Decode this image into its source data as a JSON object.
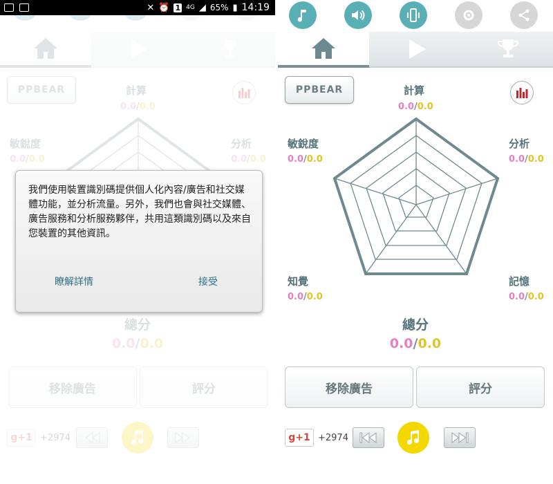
{
  "status_bar": {
    "battery": "65%",
    "time": "14:19",
    "network": "4G",
    "sim": "1"
  },
  "icons": {
    "top": [
      "music-icon",
      "volume-icon",
      "vibrate-icon",
      "settings-icon",
      "share-icon"
    ],
    "nav": [
      "home-icon",
      "play-icon",
      "trophy-icon"
    ]
  },
  "header": {
    "ppbear": "PPBEAR"
  },
  "stats": {
    "calc": {
      "label": "計算",
      "score": "0.0",
      "best": "0.0"
    },
    "sensitivity": {
      "label": "敏銳度",
      "score": "0.0",
      "best": "0.0"
    },
    "analysis": {
      "label": "分析",
      "score": "0.0",
      "best": "0.0"
    },
    "perception": {
      "label": "知覺",
      "score": "0.0",
      "best": "0.0"
    },
    "memory": {
      "label": "記憶",
      "score": "0.0",
      "best": "0.0"
    },
    "total": {
      "label": "總分",
      "score": "0.0",
      "best": "0.0"
    },
    "separator": "/"
  },
  "buttons": {
    "remove_ads": "移除廣告",
    "rate": "評分"
  },
  "social": {
    "gplus": "g+1",
    "count": "+2974"
  },
  "dialog": {
    "message": "我們使用裝置識別碼提供個人化內容/廣告和社交媒體功能，並分析流量。另外，我們也會與社交媒體、廣告服務和分析服務夥伴，共用這類識別碼以及來自您裝置的其他資訊。",
    "learn_more": "瞭解詳情",
    "accept": "接受"
  },
  "colors": {
    "teal": "#5aaeb6",
    "label": "#54737b",
    "score_pink": "#e77fc0",
    "score_yellow": "#e3c326",
    "radar": "#6e8990",
    "music_yellow": "#f3d800"
  }
}
